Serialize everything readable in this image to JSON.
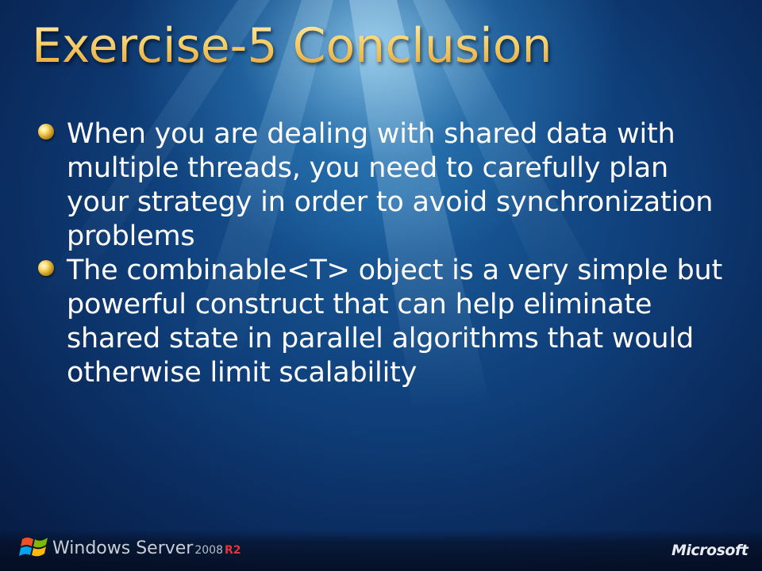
{
  "slide": {
    "title": "Exercise-5 Conclusion",
    "bullets": [
      "When you are dealing with shared data with multiple threads, you need to carefully plan your strategy in order to avoid synchronization problems",
      "The combinable<T> object is a very simple but powerful construct that can help eliminate shared state in parallel algorithms that would otherwise limit scalability"
    ],
    "bullet_icon": "gold-orb-bullet-icon"
  },
  "footer": {
    "product_logo_icon": "windows-flag-icon",
    "product_name": "Windows Server",
    "product_year": "2008",
    "product_edition": "R2",
    "company_logo": "Microsoft"
  },
  "colors": {
    "title_gold": "#f3c35a",
    "body_text": "#ffffff",
    "background_dark": "#0a2a5c",
    "background_light": "#1b5f9e",
    "r2_red": "#e0353b"
  }
}
